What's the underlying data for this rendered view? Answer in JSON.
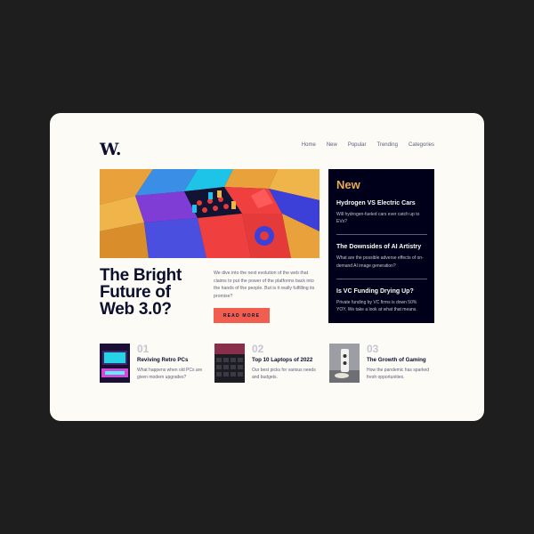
{
  "brand": {
    "logo": "W."
  },
  "nav": [
    "Home",
    "New",
    "Popular",
    "Trending",
    "Categories"
  ],
  "hero": {
    "headline": "The Bright Future of Web 3.0?",
    "description": "We dive into the next evolution of the web that claims to put the power of the platforms back into the hands of the people. But is it really fulfilling its promise?",
    "cta": "READ MORE"
  },
  "new_panel": {
    "title": "New",
    "items": [
      {
        "title": "Hydrogen VS Electric Cars",
        "desc": "Will hydrogen-fueled cars ever catch up to EVs?"
      },
      {
        "title": "The Downsides of AI Artistry",
        "desc": "What are the possible adverse effects of on-demand AI image generation?"
      },
      {
        "title": "Is VC Funding Drying Up?",
        "desc": "Private funding by VC firms is down 50% YOY. We take a look at what that means."
      }
    ]
  },
  "articles": [
    {
      "num": "01",
      "title": "Reviving Retro PCs",
      "desc": "What happens when old PCs are given modern upgrades?"
    },
    {
      "num": "02",
      "title": "Top 10 Laptops of 2022",
      "desc": "Our best picks for various needs and budgets."
    },
    {
      "num": "03",
      "title": "The Growth of Gaming",
      "desc": "How the pandemic has sparked fresh opportunities."
    }
  ],
  "colors": {
    "page_bg": "#1e1e1e",
    "card_bg": "#fcfbf6",
    "dark_navy": "#00001a",
    "accent_red": "#f15e50",
    "accent_orange": "#e9ab53",
    "text_grey": "#5d5f79",
    "light_grey": "#c5c6ce"
  }
}
